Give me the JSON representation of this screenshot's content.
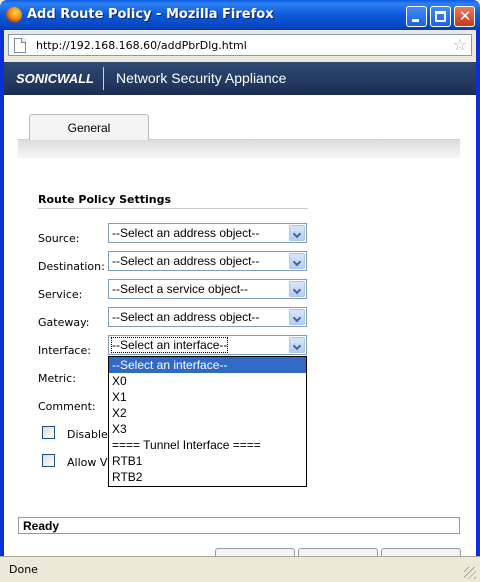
{
  "window": {
    "title": "Add Route Policy - Mozilla Firefox",
    "icon": "firefox-icon"
  },
  "addressbar": {
    "url": "http://192.168.168.60/addPbrDlg.html"
  },
  "banner": {
    "logo": "SONICWALL",
    "title": "Network Security Appliance"
  },
  "tabs": [
    {
      "label": "General",
      "selected": true
    }
  ],
  "section": {
    "title": "Route Policy Settings"
  },
  "fields": {
    "source": {
      "label": "Source:",
      "value": "--Select an address object--"
    },
    "destination": {
      "label": "Destination:",
      "value": "--Select an address object--"
    },
    "service": {
      "label": "Service:",
      "value": "--Select a service object--"
    },
    "gateway": {
      "label": "Gateway:",
      "value": "--Select an address object--"
    },
    "interface": {
      "label": "Interface:",
      "value": "--Select an interface--"
    },
    "metric": {
      "label": "Metric:"
    },
    "comment": {
      "label": "Comment:"
    }
  },
  "checkboxes": [
    {
      "label": "Disable r"
    },
    {
      "label": "Allow VP"
    }
  ],
  "interface_dropdown": {
    "options": [
      "--Select an interface--",
      "X0",
      "X1",
      "X2",
      "X3",
      "==== Tunnel Interface ====",
      "RTB1",
      "RTB2"
    ],
    "highlighted_index": 0
  },
  "status": {
    "text": "Ready"
  },
  "browser_status": {
    "text": "Done"
  },
  "colors": {
    "titlebar": "#0a5ce6",
    "banner": "#1b2e52",
    "selection": "#316ac5",
    "window_border": "#0831d9"
  }
}
